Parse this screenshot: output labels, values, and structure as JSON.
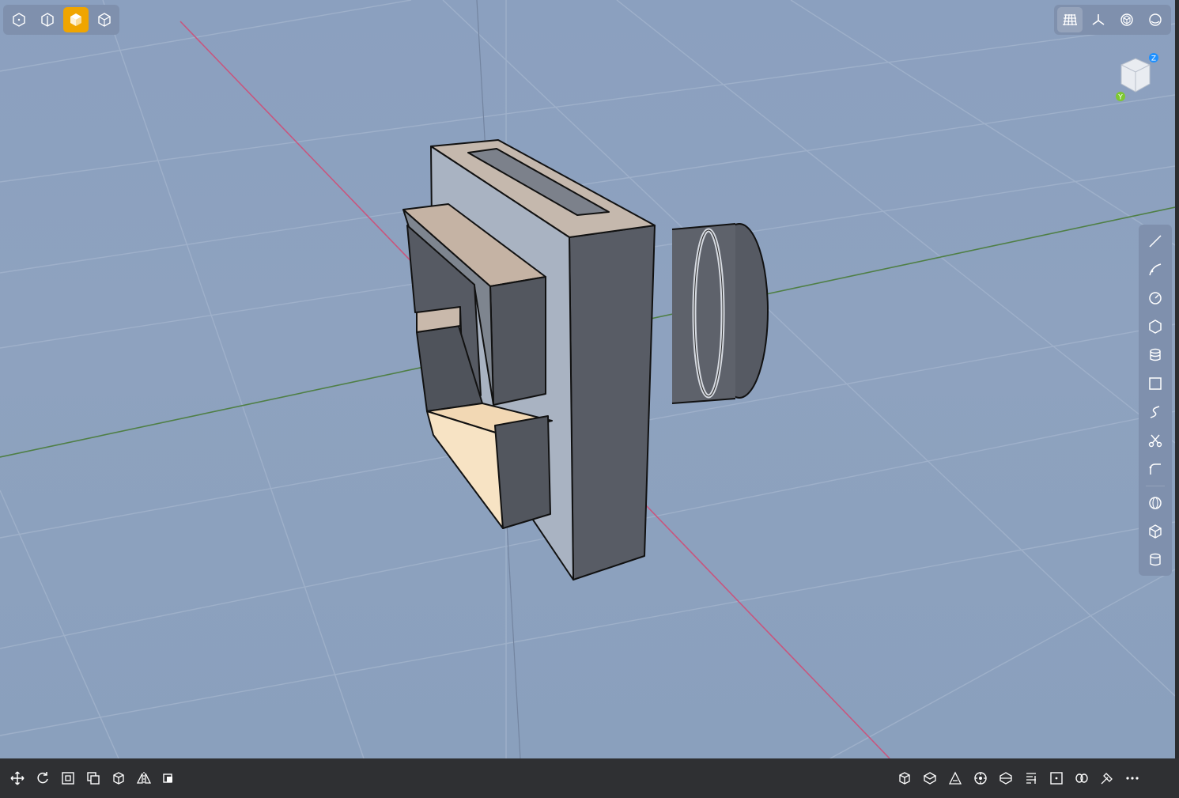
{
  "viewport": {
    "background": "#8ba0bf",
    "axis_colors": {
      "x": "#c8567e",
      "y": "#4f7f45",
      "z": "#6f84a4"
    }
  },
  "view_mode_toolbar": {
    "items": [
      {
        "icon": "wireframe-cube-icon",
        "active": false
      },
      {
        "icon": "shaded-edges-cube-icon",
        "active": false
      },
      {
        "icon": "shaded-cube-icon",
        "active": true
      },
      {
        "icon": "xray-cube-icon",
        "active": false
      }
    ],
    "active_color": "#f0a500"
  },
  "display_toolbar": {
    "items": [
      {
        "icon": "grid-icon",
        "active": true
      },
      {
        "icon": "axes-icon",
        "active": false
      },
      {
        "icon": "sphere-cube-icon",
        "active": false
      },
      {
        "icon": "orbit-icon",
        "active": false
      }
    ]
  },
  "orientation_gizmo": {
    "z_label": "Z",
    "y_label": "Y",
    "z_color": "#1e90ff",
    "y_color": "#7ec832"
  },
  "sketch_toolbar": {
    "items": [
      "line-icon",
      "arc-icon",
      "circle-icon",
      "polygon-icon",
      "layers-icon",
      "rectangle-icon",
      "spline-icon",
      "scissors-icon",
      "fillet-icon",
      "sphere-icon",
      "cube-icon",
      "cylinder-icon"
    ]
  },
  "bottom_toolbar": {
    "left_items": [
      "move-icon",
      "rotate-icon",
      "scale-icon",
      "copy-icon",
      "extrude-icon",
      "mirror-icon",
      "boolean-icon"
    ],
    "right_items": [
      "box-add-icon",
      "shell-icon",
      "chamfer-icon",
      "target-icon",
      "slice-icon",
      "align-icon",
      "frame-icon",
      "loft-icon",
      "measure-icon",
      "more-icon"
    ]
  }
}
